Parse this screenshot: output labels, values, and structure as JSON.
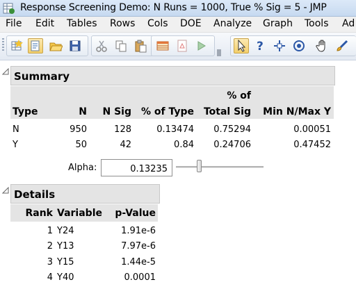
{
  "window": {
    "title": "Response Screening Demo: N Runs = 1000, True % Sig = 5 - JMP"
  },
  "menu": [
    "File",
    "Edit",
    "Tables",
    "Rows",
    "Cols",
    "DOE",
    "Analyze",
    "Graph",
    "Tools",
    "Ad"
  ],
  "toolbar": {
    "buttons": [
      "new-data-table-icon",
      "new-script-icon",
      "open-icon",
      "save-icon",
      "cut-icon",
      "copy-icon",
      "paste-icon",
      "data-grid-icon",
      "report-icon",
      "run-icon",
      "arrow-tool-icon",
      "help-tool-icon",
      "crosshair-tool-icon",
      "lasso-tool-icon",
      "hand-tool-icon",
      "brush-tool-icon"
    ]
  },
  "summary": {
    "title": "Summary",
    "headers": {
      "type": "Type",
      "n": "N",
      "n_sig": "N Sig",
      "pct_type": "% of Type",
      "pct_total_line1": "% of",
      "pct_total_line2": "Total Sig",
      "min_max": "Min N/Max Y"
    },
    "rows": [
      {
        "type": "N",
        "n": "950",
        "n_sig": "128",
        "pct_type": "0.13474",
        "pct_total": "0.75294",
        "min_max": "0.00051"
      },
      {
        "type": "Y",
        "n": "50",
        "n_sig": "42",
        "pct_type": "0.84",
        "pct_total": "0.24706",
        "min_max": "0.47452"
      }
    ],
    "alpha_label": "Alpha:",
    "alpha_value": "0.13235"
  },
  "details": {
    "title": "Details",
    "headers": {
      "rank": "Rank",
      "variable": "Variable",
      "pvalue": "p-Value"
    },
    "rows": [
      {
        "rank": "1",
        "variable": "Y24",
        "pvalue": "1.91e-6"
      },
      {
        "rank": "2",
        "variable": "Y13",
        "pvalue": "7.97e-6"
      },
      {
        "rank": "3",
        "variable": "Y15",
        "pvalue": "1.44e-5"
      },
      {
        "rank": "4",
        "variable": "Y40",
        "pvalue": "0.0001"
      }
    ]
  },
  "colors": {
    "header_bg": "#e4e4e4",
    "titlebar": "#c6d9f0",
    "active_tool": "#f3cf6b"
  }
}
